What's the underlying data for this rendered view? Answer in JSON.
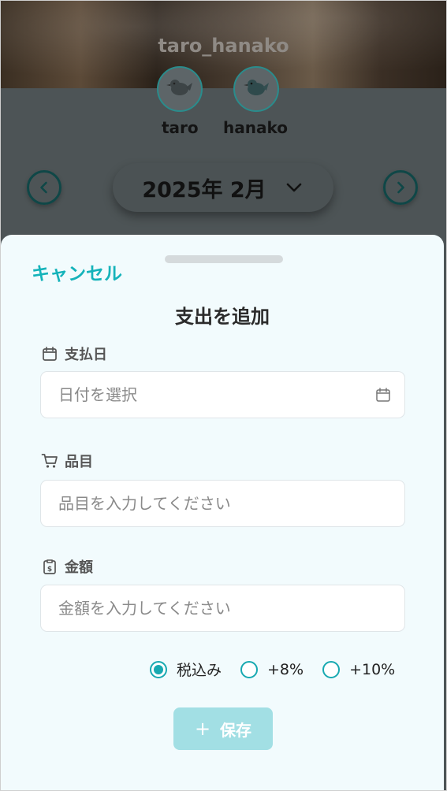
{
  "header": {
    "group_name": "taro_hanako",
    "members": [
      {
        "name": "taro",
        "avatar_icon": "bird-avatar-icon"
      },
      {
        "name": "hanako",
        "avatar_icon": "bird-avatar-icon"
      }
    ]
  },
  "month_nav": {
    "current_month": "2025年 2月",
    "prev_icon": "chevron-left-icon",
    "next_icon": "chevron-right-icon",
    "dropdown_icon": "chevron-down-icon"
  },
  "sheet": {
    "cancel_label": "キャンセル",
    "title": "支出を追加",
    "fields": {
      "date": {
        "label": "支払日",
        "placeholder": "日付を選択",
        "value": ""
      },
      "item": {
        "label": "品目",
        "placeholder": "品目を入力してください",
        "value": ""
      },
      "amount": {
        "label": "金額",
        "placeholder": "金額を入力してください",
        "value": ""
      }
    },
    "tax_options": [
      {
        "label": "税込み",
        "selected": true
      },
      {
        "label": "+8%",
        "selected": false
      },
      {
        "label": "+10%",
        "selected": false
      }
    ],
    "save_label": "保存"
  },
  "colors": {
    "accent": "#18a9b1",
    "save_button_disabled": "#a2dfe4",
    "sheet_background": "#f2fbfd",
    "overlay_background": "#4d5456"
  }
}
